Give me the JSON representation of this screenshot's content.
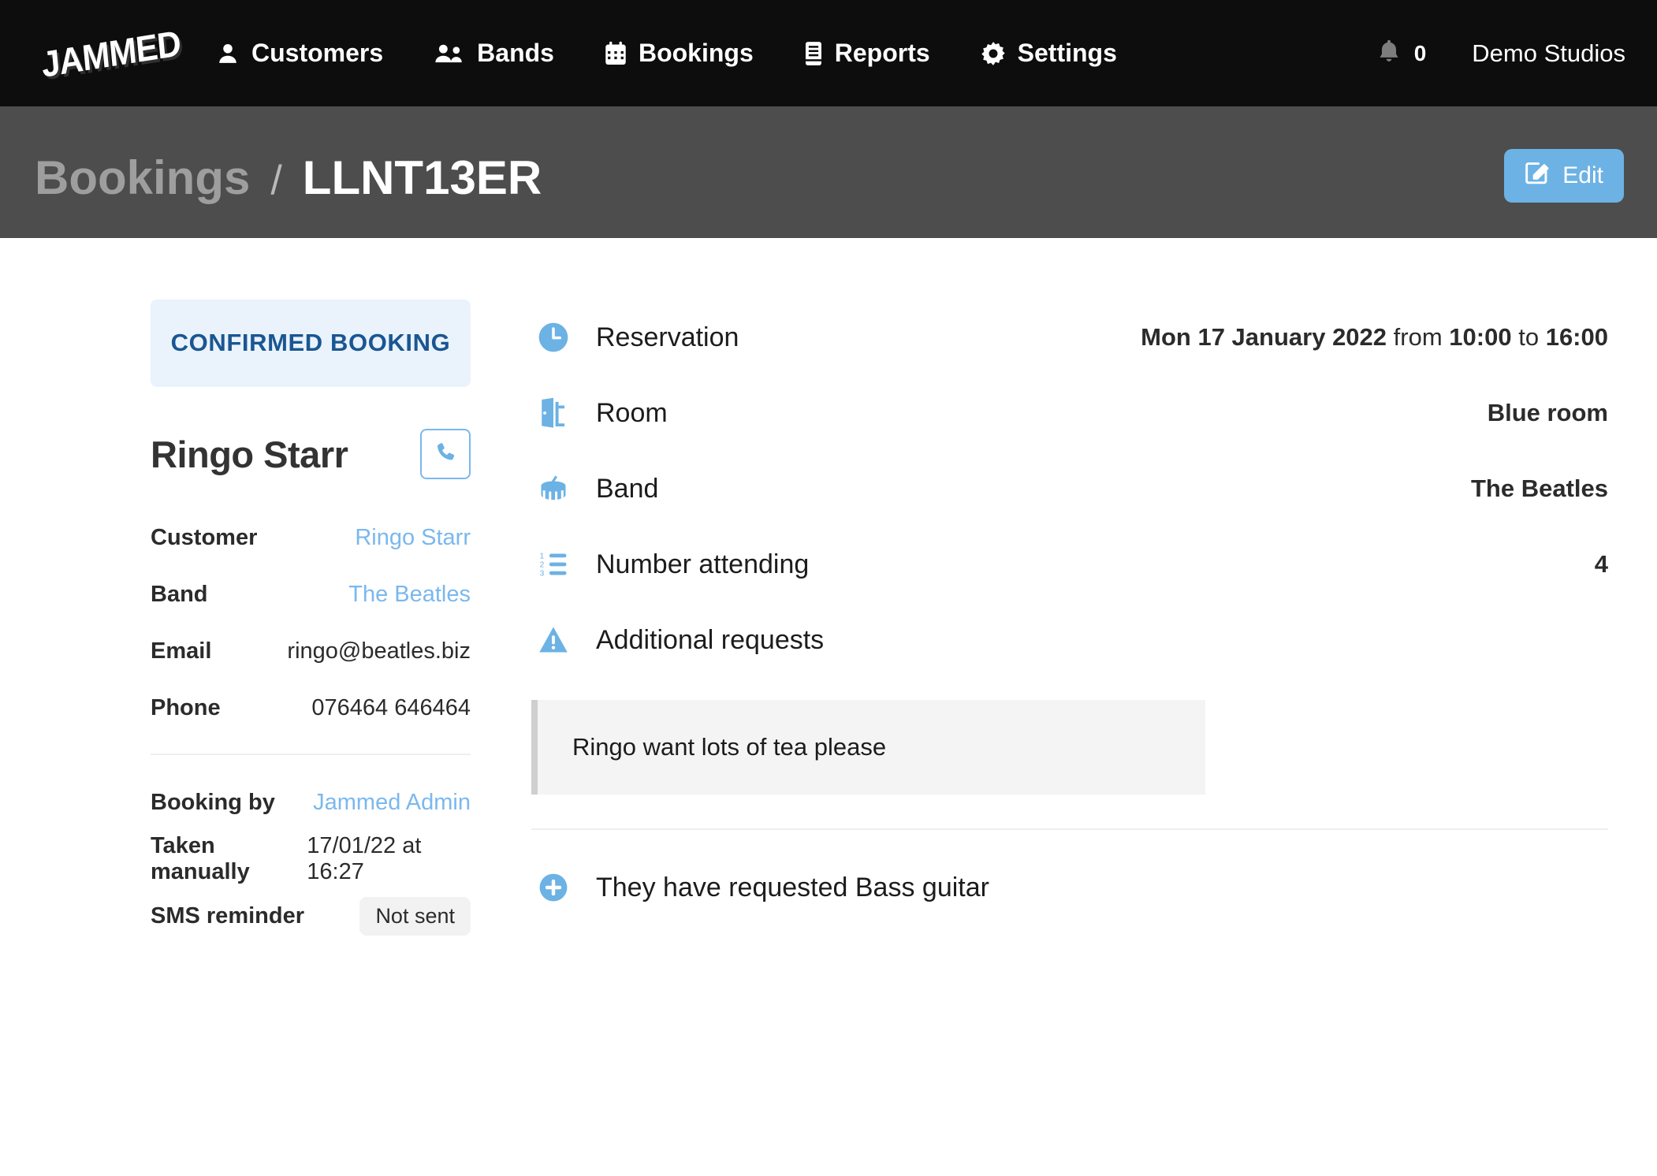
{
  "navbar": {
    "logo_text": "JAMMED",
    "items": [
      {
        "label": "Customers",
        "icon": "user-icon"
      },
      {
        "label": "Bands",
        "icon": "users-icon"
      },
      {
        "label": "Bookings",
        "icon": "calendar-icon"
      },
      {
        "label": "Reports",
        "icon": "book-icon"
      },
      {
        "label": "Settings",
        "icon": "gear-icon"
      }
    ],
    "notifications_count": "0",
    "org_name": "Demo Studios"
  },
  "header": {
    "breadcrumb_parent": "Bookings",
    "breadcrumb_separator": "/",
    "breadcrumb_current": "LLNT13ER",
    "edit_label": "Edit"
  },
  "sidebar": {
    "status": "CONFIRMED BOOKING",
    "customer_name": "Ringo Starr",
    "rows": [
      {
        "label": "Customer",
        "value": "Ringo Starr",
        "link": true
      },
      {
        "label": "Band",
        "value": "The Beatles",
        "link": true
      },
      {
        "label": "Email",
        "value": "ringo@beatles.biz",
        "link": false
      },
      {
        "label": "Phone",
        "value": "076464 646464",
        "link": false
      }
    ],
    "rows2": [
      {
        "label": "Booking by",
        "value": "Jammed Admin",
        "link": true
      },
      {
        "label": "Taken manually",
        "value": "17/01/22 at 16:27",
        "link": false
      },
      {
        "label": "SMS reminder",
        "value": "Not sent",
        "link": false,
        "pill": true
      }
    ]
  },
  "main": {
    "reservation": {
      "label": "Reservation",
      "date": "Mon 17 January 2022",
      "from_word": "from",
      "start_time": "10:00",
      "to_word": "to",
      "end_time": "16:00"
    },
    "room": {
      "label": "Room",
      "value": "Blue room"
    },
    "band": {
      "label": "Band",
      "value": "The Beatles"
    },
    "attending": {
      "label": "Number attending",
      "value": "4"
    },
    "additional_requests": {
      "label": "Additional requests",
      "note": "Ringo want lots of tea please"
    },
    "requested_equipment": "They have requested Bass guitar"
  },
  "colors": {
    "nav_bg": "#0d0d0d",
    "header_bg": "#4d4d4d",
    "accent_blue": "#6cb2e4",
    "link_blue": "#7ab8ee",
    "status_bg": "#eaf3fb",
    "status_fg": "#1a5692"
  }
}
